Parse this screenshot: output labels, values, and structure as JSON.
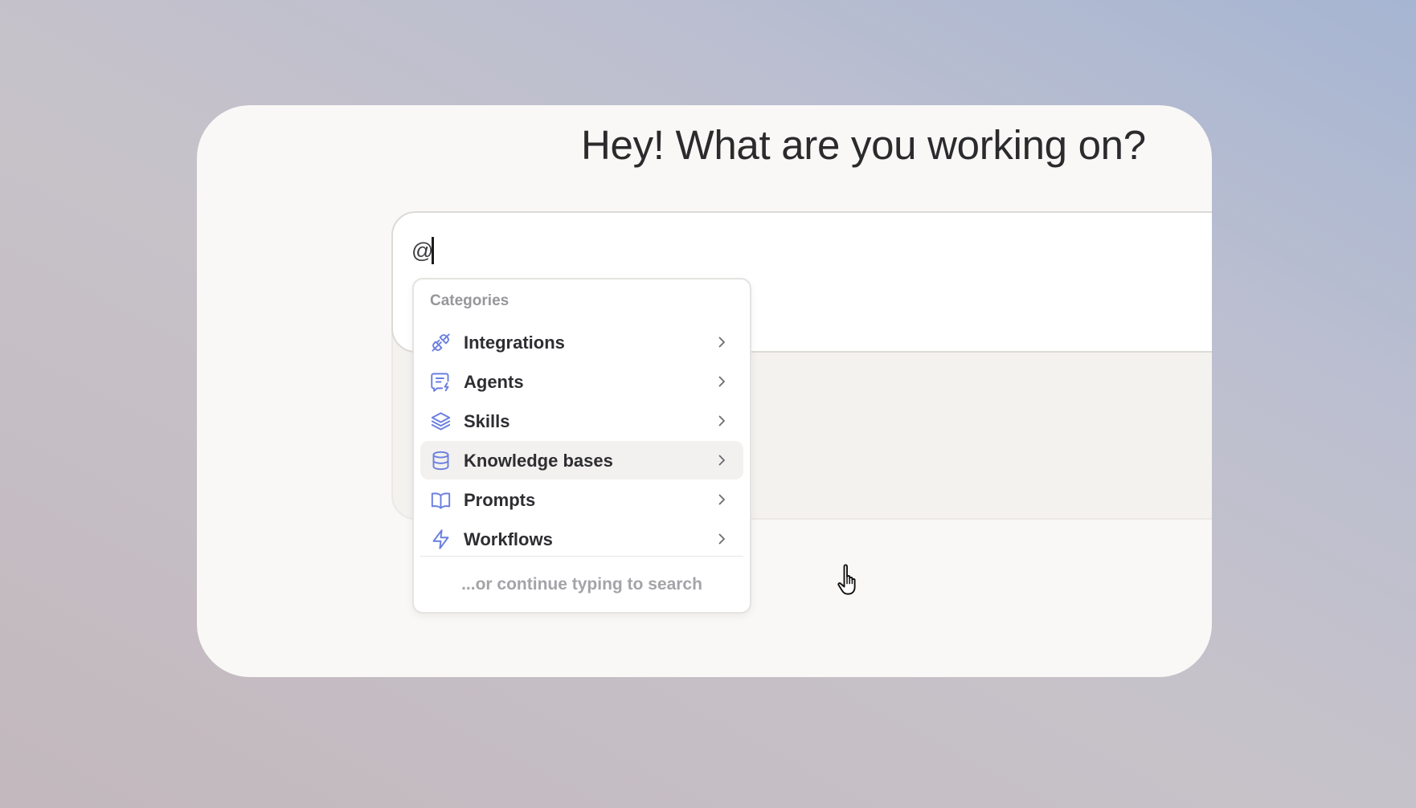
{
  "headline": "Hey! What are you working on?",
  "composer": {
    "value": "@"
  },
  "menu": {
    "header": "Categories",
    "items": [
      {
        "label": "Integrations",
        "icon": "plug-icon"
      },
      {
        "label": "Agents",
        "icon": "chat-bolt-icon"
      },
      {
        "label": "Skills",
        "icon": "layers-icon"
      },
      {
        "label": "Knowledge bases",
        "icon": "database-icon"
      },
      {
        "label": "Prompts",
        "icon": "book-icon"
      },
      {
        "label": "Workflows",
        "icon": "lightning-icon"
      }
    ],
    "hovered_item": "Knowledge bases",
    "footer": "...or continue typing to search"
  },
  "colors": {
    "icon_accent": "#6a7fe0",
    "hover_background": "#f2f1ef",
    "card_background": "#f9f8f6"
  }
}
